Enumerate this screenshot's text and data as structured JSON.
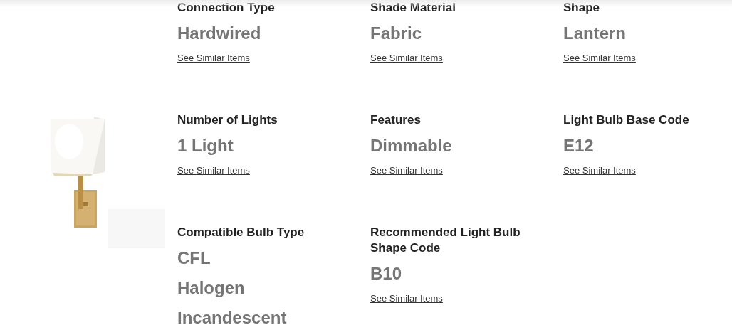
{
  "specs": [
    [
      {
        "label": "Connection Type",
        "values": [
          "Hardwired"
        ],
        "link": "See Similar Items"
      },
      {
        "label": "Shade Material",
        "values": [
          "Fabric"
        ],
        "link": "See Similar Items"
      },
      {
        "label": "Shape",
        "values": [
          "Lantern"
        ],
        "link": "See Similar Items"
      }
    ],
    [
      {
        "label": "Number of Lights",
        "values": [
          "1 Light"
        ],
        "link": "See Similar Items"
      },
      {
        "label": "Features",
        "values": [
          "Dimmable"
        ],
        "link": "See Similar Items"
      },
      {
        "label": "Light Bulb Base Code",
        "values": [
          "E12"
        ],
        "link": "See Similar Items"
      }
    ],
    [
      {
        "label": "Compatible Bulb Type",
        "values": [
          "CFL",
          "Halogen",
          "Incandescent"
        ]
      },
      {
        "label": "Recommended Light Bulb Shape Code",
        "values": [
          "B10"
        ],
        "link": "See Similar Items"
      }
    ]
  ],
  "product_image": {
    "kind": "picture"
  }
}
